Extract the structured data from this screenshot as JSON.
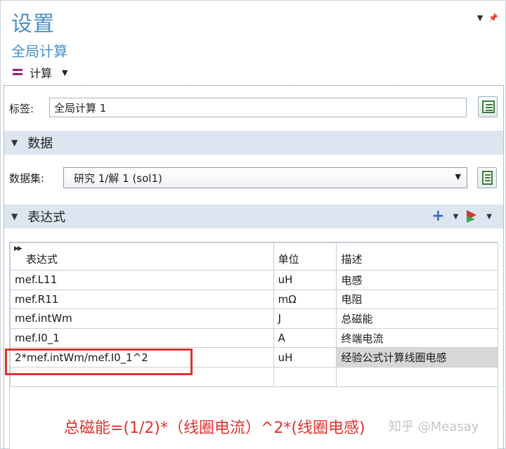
{
  "header": {
    "title": "设置",
    "subtitle": "全局计算",
    "node_label": "计算"
  },
  "label_field": {
    "label": "标签:",
    "value": "全局计算 1"
  },
  "data_section": {
    "title": "数据",
    "dataset_label": "数据集:",
    "dataset_value": "研究 1/解 1 (sol1)"
  },
  "expr_section": {
    "title": "表达式",
    "columns": [
      "表达式",
      "单位",
      "描述"
    ],
    "rows": [
      {
        "expr": "mef.L11",
        "unit": "uH",
        "desc": "电感"
      },
      {
        "expr": "mef.R11",
        "unit": "mΩ",
        "desc": "电阻"
      },
      {
        "expr": "mef.intWm",
        "unit": "J",
        "desc": "总磁能"
      },
      {
        "expr": "mef.I0_1",
        "unit": "A",
        "desc": "终端电流"
      },
      {
        "expr": "2*mef.intWm/mef.I0_1^2",
        "unit": "uH",
        "desc": "经验公式计算线圈电感"
      },
      {
        "expr": "",
        "unit": "",
        "desc": ""
      }
    ]
  },
  "annotation": "总磁能=(1/2)*（线圈电流）^2*(线圈电感)",
  "watermark": "知乎 @Measay",
  "icons": [
    "eq-icon",
    "label-doc-icon",
    "dataset-doc-icon",
    "add-icon",
    "flag-icon",
    "pin-icon"
  ],
  "colors": {
    "title_blue": "#4a90c8",
    "section_bg": "#dde6f0",
    "annotation_red": "#e0322e"
  }
}
